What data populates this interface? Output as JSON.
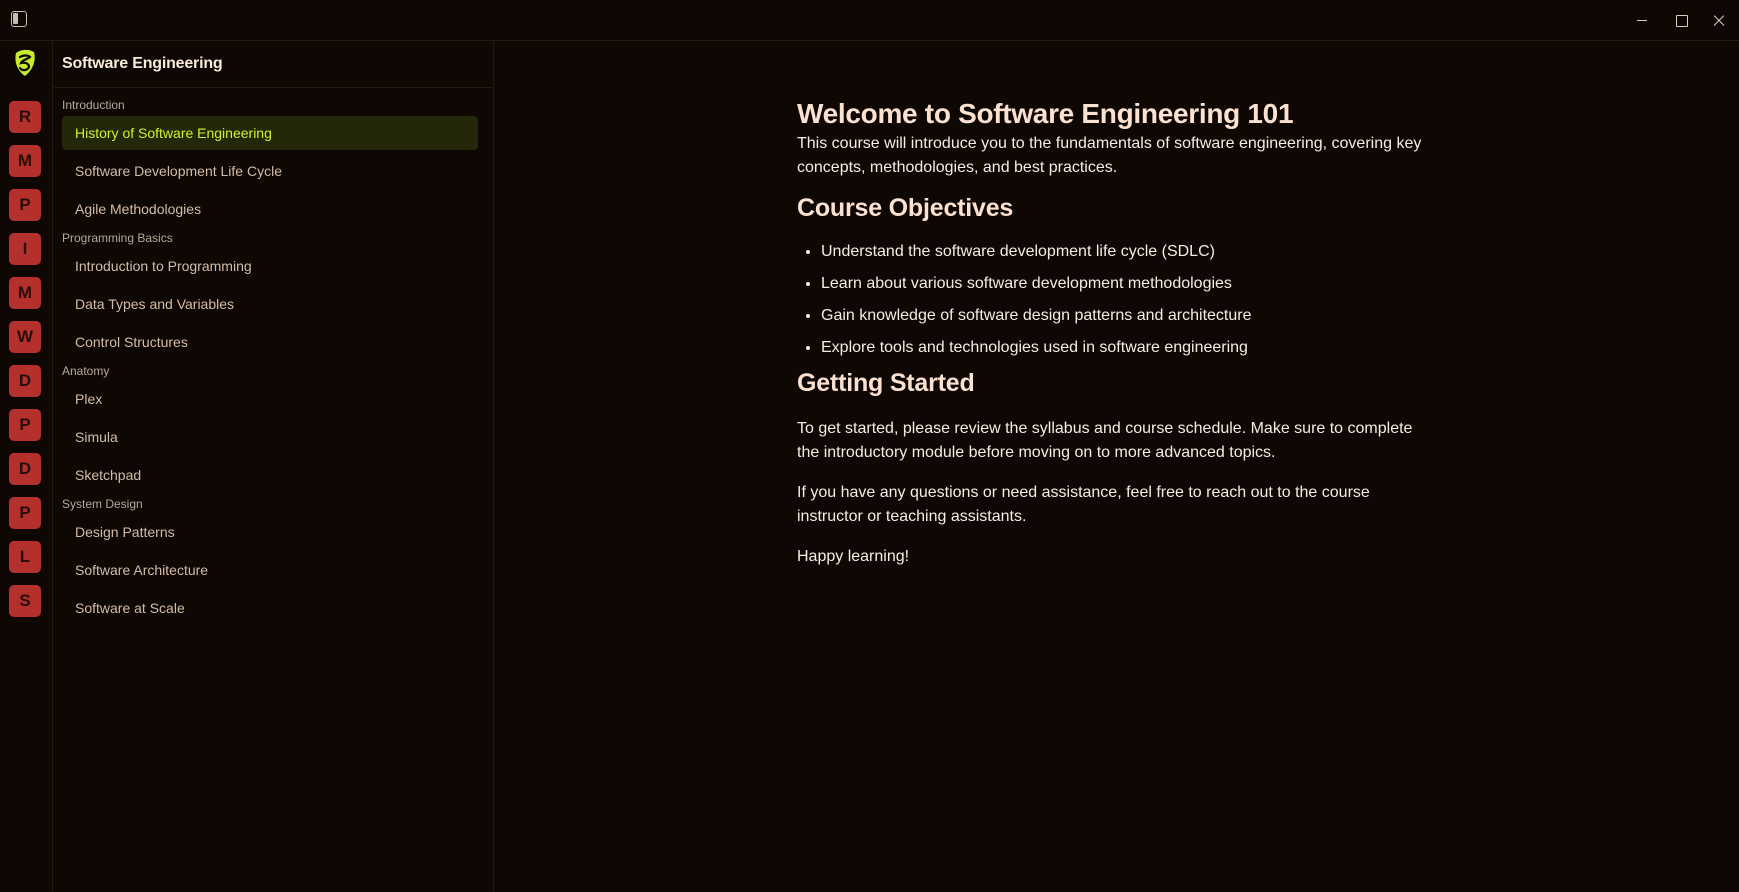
{
  "window": {
    "controls": [
      "minimize-icon",
      "maximize-icon",
      "close-icon"
    ]
  },
  "rail": {
    "items": [
      "R",
      "M",
      "P",
      "I",
      "M",
      "W",
      "D",
      "P",
      "D",
      "P",
      "L",
      "S"
    ],
    "accent": "#b3302c"
  },
  "nav": {
    "title": "Software Engineering",
    "sections": [
      {
        "label": "Introduction",
        "items": [
          "History of Software Engineering",
          "Software Development Life Cycle",
          "Agile Methodologies"
        ]
      },
      {
        "label": "Programming Basics",
        "items": [
          "Introduction to Programming",
          "Data Types and Variables",
          "Control Structures"
        ]
      },
      {
        "label": "Anatomy",
        "items": [
          "Plex",
          "Simula",
          "Sketchpad"
        ]
      },
      {
        "label": "System Design",
        "items": [
          "Design Patterns",
          "Software Architecture",
          "Software at Scale"
        ]
      }
    ],
    "active_item": "History of Software Engineering",
    "active_color": "#d2ef32"
  },
  "content": {
    "heading": "Welcome to Software Engineering 101",
    "intro": "This course will introduce you to the fundamentals of software engineering, covering key concepts, methodologies, and best practices.",
    "objectives_heading": "Course Objectives",
    "objectives": [
      "Understand the software development life cycle (SDLC)",
      "Learn about various software development methodologies",
      "Gain knowledge of software design patterns and architecture",
      "Explore tools and technologies used in software engineering"
    ],
    "started_heading": "Getting Started",
    "started_p1": "To get started, please review the syllabus and course schedule. Make sure to complete the introductory module before moving on to more advanced topics.",
    "started_p2": "If you have any questions or need assistance, feel free to reach out to the course instructor or teaching assistants.",
    "closing": "Happy learning!"
  }
}
